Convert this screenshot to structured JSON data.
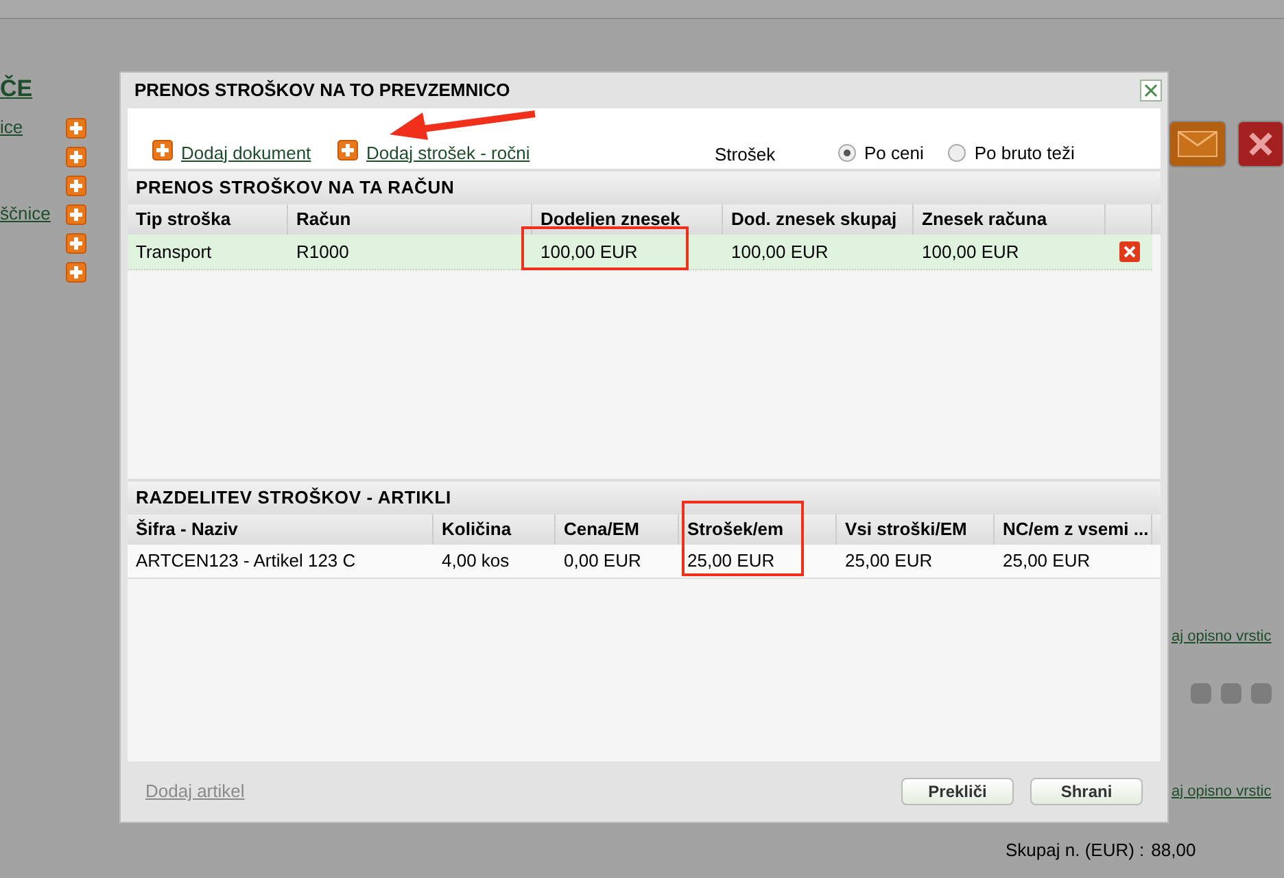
{
  "background": {
    "heading": "ČE",
    "links": [
      {
        "label": "ice"
      },
      {
        "label": "ščnice"
      }
    ],
    "right_links": [
      "aj opisno vrstic",
      "aj opisno vrstic"
    ],
    "faded_link": "Dodaj artikel",
    "total": {
      "label": "Skupaj n. (EUR) :",
      "value": "88,00"
    }
  },
  "dialog": {
    "title": "PRENOS STROŠKOV NA TO PREVZEMNICO",
    "toolbar_links": [
      "Dodaj dokument",
      "Dodaj strošek - ročni"
    ],
    "distribution": {
      "label": "Strošek",
      "options": [
        {
          "label": "Po ceni",
          "selected": true
        },
        {
          "label": "Po bruto teži",
          "selected": false
        }
      ]
    },
    "costs": {
      "title": "PRENOS STROŠKOV NA TA RAČUN",
      "columns": [
        "Tip stroška",
        "Račun",
        "Dodeljen znesek",
        "Dod. znesek skupaj",
        "Znesek računa"
      ],
      "rows": [
        {
          "cells": [
            "Transport",
            "R1000",
            "100,00 EUR",
            "100,00 EUR",
            "100,00 EUR"
          ],
          "selected": true
        }
      ]
    },
    "items": {
      "title": "RAZDELITEV STROŠKOV - ARTIKLI",
      "columns": [
        "Šifra - Naziv",
        "Količina",
        "Cena/EM",
        "Strošek/em",
        "Vsi stroški/EM",
        "NC/em z vsemi ..."
      ],
      "rows": [
        {
          "cells": [
            "ARTCEN123 - Artikel 123 C",
            "4,00 kos",
            "0,00 EUR",
            "25,00 EUR",
            "25,00 EUR",
            "25,00 EUR"
          ]
        }
      ]
    },
    "buttons": [
      "Prekliči",
      "Shrani"
    ]
  }
}
